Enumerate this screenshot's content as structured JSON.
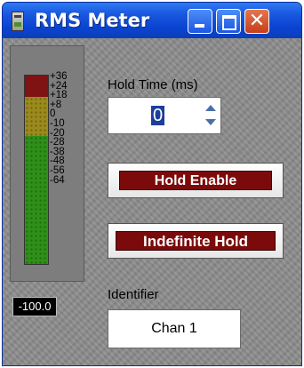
{
  "window": {
    "title": "RMS Meter"
  },
  "meter": {
    "scale_labels": [
      "+36",
      "+24",
      "+18",
      "+8",
      "0",
      "-10",
      "-20",
      "-28",
      "-38",
      "-48",
      "-56",
      "-64"
    ],
    "readout": "-100.0",
    "colors": {
      "red": "#7f1212",
      "yellow": "#9b8a1c",
      "green": "#2f8f18"
    }
  },
  "hold_time": {
    "label": "Hold Time (ms)",
    "value": "0"
  },
  "buttons": {
    "hold_enable": "Hold Enable",
    "indefinite_hold": "Indefinite Hold"
  },
  "identifier": {
    "label": "Identifier",
    "value": "Chan  1"
  }
}
